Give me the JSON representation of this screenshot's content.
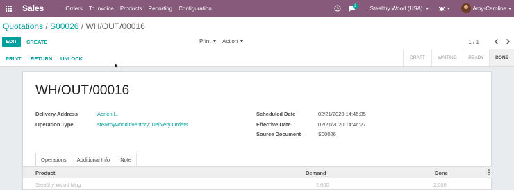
{
  "topbar": {
    "app_name": "Sales",
    "menu": [
      "Orders",
      "To Invoice",
      "Products",
      "Reporting",
      "Configuration"
    ],
    "chat_count": "3",
    "company": "Stealthy Wood (USA)",
    "user": "Amy-Caroline",
    "accent": "#875a7b"
  },
  "breadcrumb": {
    "level1": "Quotations",
    "sep": " / ",
    "level2": "S00026",
    "current": "WH/OUT/00016"
  },
  "toolbar": {
    "edit": "EDIT",
    "create": "CREATE",
    "print": "Print",
    "action": "Action",
    "pager": "1 / 1"
  },
  "statusbar": {
    "buttons": [
      "PRINT",
      "RETURN",
      "UNLOCK"
    ],
    "stages": [
      "DRAFT",
      "WAITING",
      "READY",
      "DONE"
    ],
    "active_stage": "DONE"
  },
  "form": {
    "title": "WH/OUT/00016",
    "delivery_address_label": "Delivery Address",
    "delivery_address": "Adrien L.",
    "operation_type_label": "Operation Type",
    "operation_type": "stealthywoodinventory: Delivery Orders",
    "scheduled_date_label": "Scheduled Date",
    "scheduled_date": "02/21/2020 14:45:35",
    "effective_date_label": "Effective Date",
    "effective_date": "02/21/2020 14:46:27",
    "source_document_label": "Source Document",
    "source_document": "S00026"
  },
  "tabs": [
    "Operations",
    "Additional Info",
    "Note"
  ],
  "table": {
    "columns": [
      "Product",
      "Demand",
      "Done"
    ],
    "rows": [
      {
        "product": "Stealthy Wood Mug",
        "demand": "2.000",
        "done": "2.000"
      }
    ]
  }
}
